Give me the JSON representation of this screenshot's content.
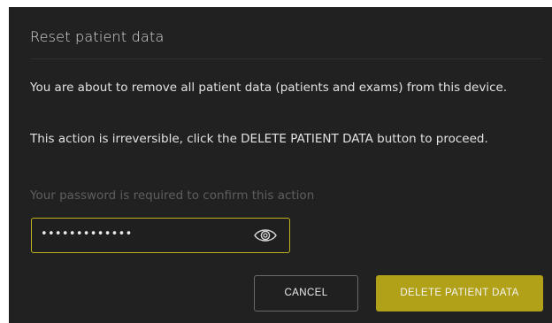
{
  "dialog": {
    "title": "Reset patient data",
    "message_1": "You are about to remove all patient data (patients and exams) from this device.",
    "message_2": "This action is irreversible, click the DELETE PATIENT DATA button to proceed.",
    "password_hint": "Your password is required to confirm this action",
    "password_value": "•••••••••••••",
    "cancel_label": "CANCEL",
    "delete_label": "DELETE PATIENT DATA"
  },
  "icons": {
    "toggle_visibility": "eye-icon"
  },
  "colors": {
    "background": "#212121",
    "accent": "#b1a118",
    "field_border": "#c2b11e",
    "hint_text": "#5e5e5e"
  }
}
